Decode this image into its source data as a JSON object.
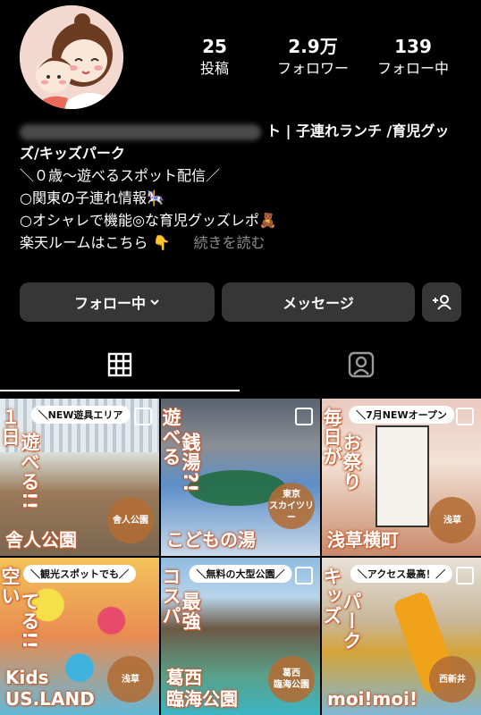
{
  "profile": {
    "stats": [
      {
        "num": "25",
        "label": "投稿"
      },
      {
        "num": "2.9万",
        "label": "フォロワー"
      },
      {
        "num": "139",
        "label": "フォロー中"
      }
    ],
    "bio": {
      "name_visible": "ト | 子連れランチ /育児グッ",
      "name_line2": "ズ/キッズパーク",
      "line1": "＼０歳〜遊べるスポット配信／",
      "line2": "○関東の子連れ情報🎠",
      "line3": "○オシャレで機能◎な育児グッズレポ🧸",
      "line4": "楽天ルームはこちら 👇",
      "more": "続きを読む"
    }
  },
  "actions": {
    "follow_label": "フォロー中",
    "message_label": "メッセージ"
  },
  "tabs": [
    "grid",
    "tagged"
  ],
  "posts": [
    {
      "badge": "＼NEW遊具エリア",
      "title_a": "１日",
      "title_b": "遊べる!!",
      "place": "舎人公園",
      "loc": "舎人公園"
    },
    {
      "badge": "",
      "title_a": "遊べる",
      "title_b": "銭湯?!",
      "place": "こどもの湯",
      "loc": "東京\nスカイツリー"
    },
    {
      "badge": "＼7月NEWオープン",
      "title_a": "毎日が",
      "title_b": "お祭り",
      "place": "浅草横町",
      "loc": "浅草"
    },
    {
      "badge": "＼観光スポットでも／",
      "title_a": "空い",
      "title_b": "てる!!",
      "place": "Kids\nUS.LAND",
      "loc": "浅草"
    },
    {
      "badge": "＼無料の大型公園／",
      "title_a": "コスパ",
      "title_b": "最強",
      "place": "葛西\n臨海公園",
      "loc": "葛西\n臨海公園"
    },
    {
      "badge": "＼アクセス最高！／",
      "title_a": "キッズ",
      "title_b": "パーク",
      "place": "moi!moi!",
      "loc": "西新井"
    }
  ],
  "colors": {
    "button_bg": "#363636",
    "accent_text": "#c25a2c",
    "muted": "#8e8e8e"
  }
}
